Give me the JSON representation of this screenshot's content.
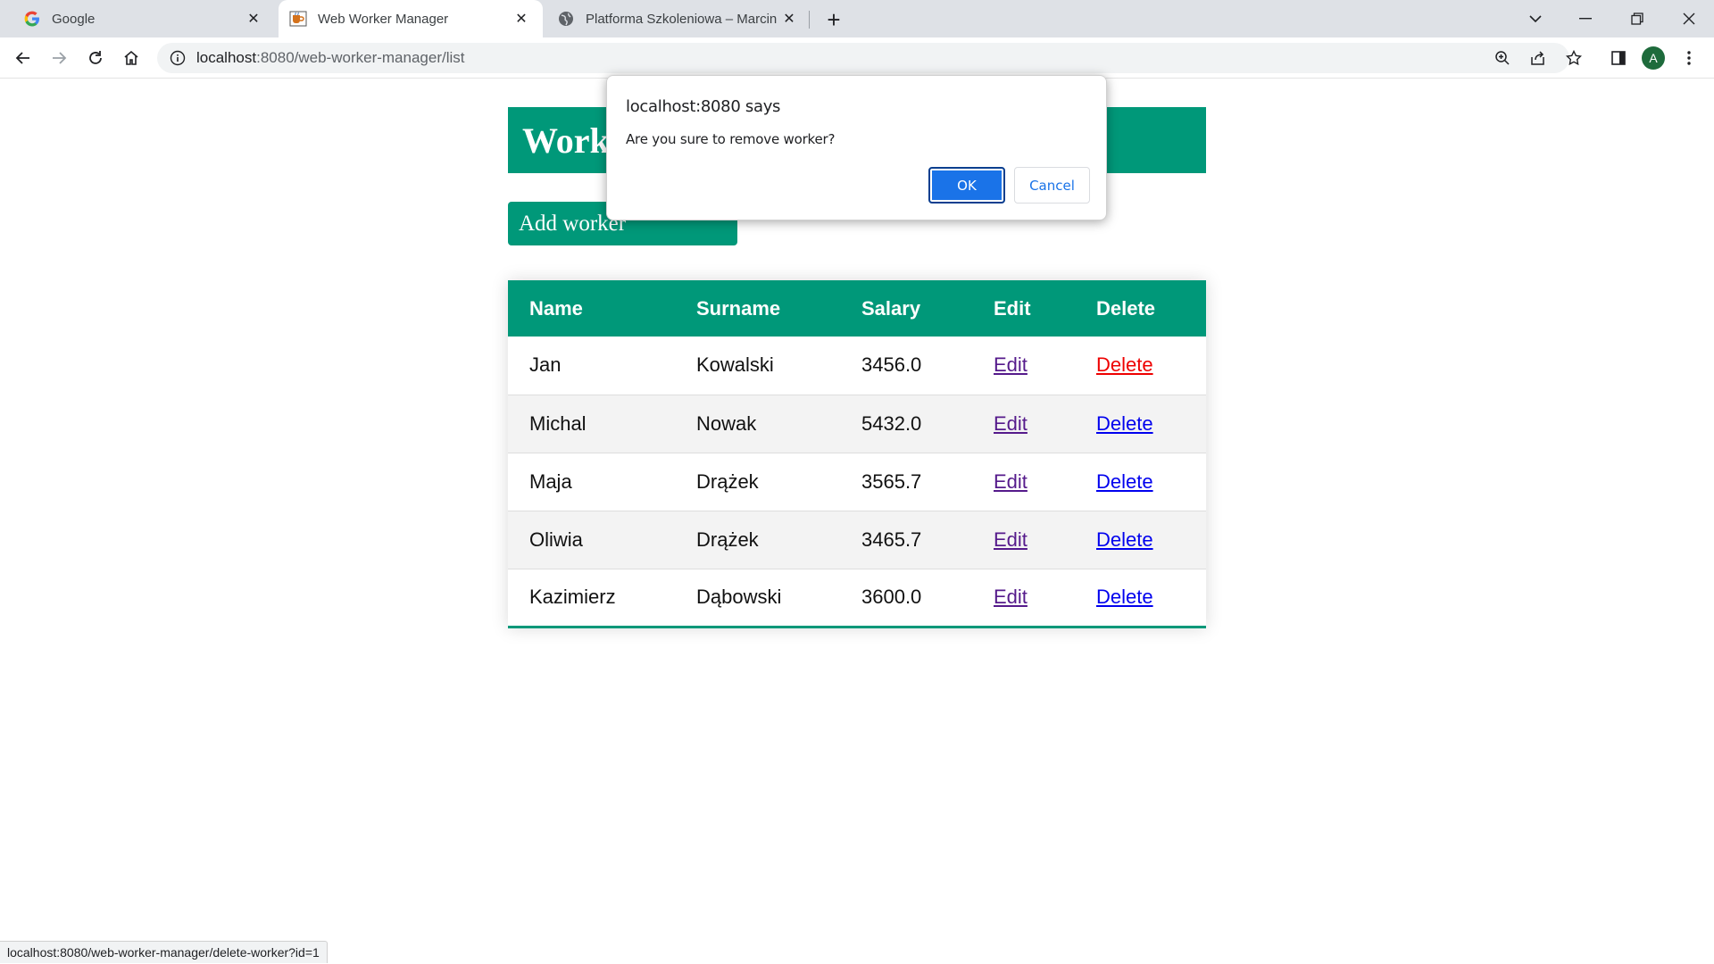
{
  "browser": {
    "tabs": [
      {
        "title": "Google",
        "active": false
      },
      {
        "title": "Web Worker Manager",
        "active": true
      },
      {
        "title": "Platforma Szkoleniowa – Marcin",
        "active": false
      }
    ],
    "address": {
      "host": "localhost",
      "path": ":8080/web-worker-manager/list"
    },
    "profile_initial": "A",
    "status_url": "localhost:8080/web-worker-manager/delete-worker?id=1"
  },
  "page": {
    "heading": "Worker",
    "add_button": "Add worker",
    "table": {
      "columns": [
        "Name",
        "Surname",
        "Salary",
        "Edit",
        "Delete"
      ],
      "rows": [
        {
          "name": "Jan",
          "surname": "Kowalski",
          "salary": "3456.0",
          "edit": "Edit",
          "delete": "Delete"
        },
        {
          "name": "Michal",
          "surname": "Nowak",
          "salary": "5432.0",
          "edit": "Edit",
          "delete": "Delete"
        },
        {
          "name": "Maja",
          "surname": "Drążek",
          "salary": "3565.7",
          "edit": "Edit",
          "delete": "Delete"
        },
        {
          "name": "Oliwia",
          "surname": "Drążek",
          "salary": "3465.7",
          "edit": "Edit",
          "delete": "Delete"
        },
        {
          "name": "Kazimierz",
          "surname": "Dąbowski",
          "salary": "3600.0",
          "edit": "Edit",
          "delete": "Delete"
        }
      ]
    }
  },
  "dialog": {
    "title": "localhost:8080 says",
    "message": "Are you sure to remove worker?",
    "ok": "OK",
    "cancel": "Cancel"
  },
  "colors": {
    "accent": "#009879",
    "dialog_primary": "#1a73e8"
  }
}
